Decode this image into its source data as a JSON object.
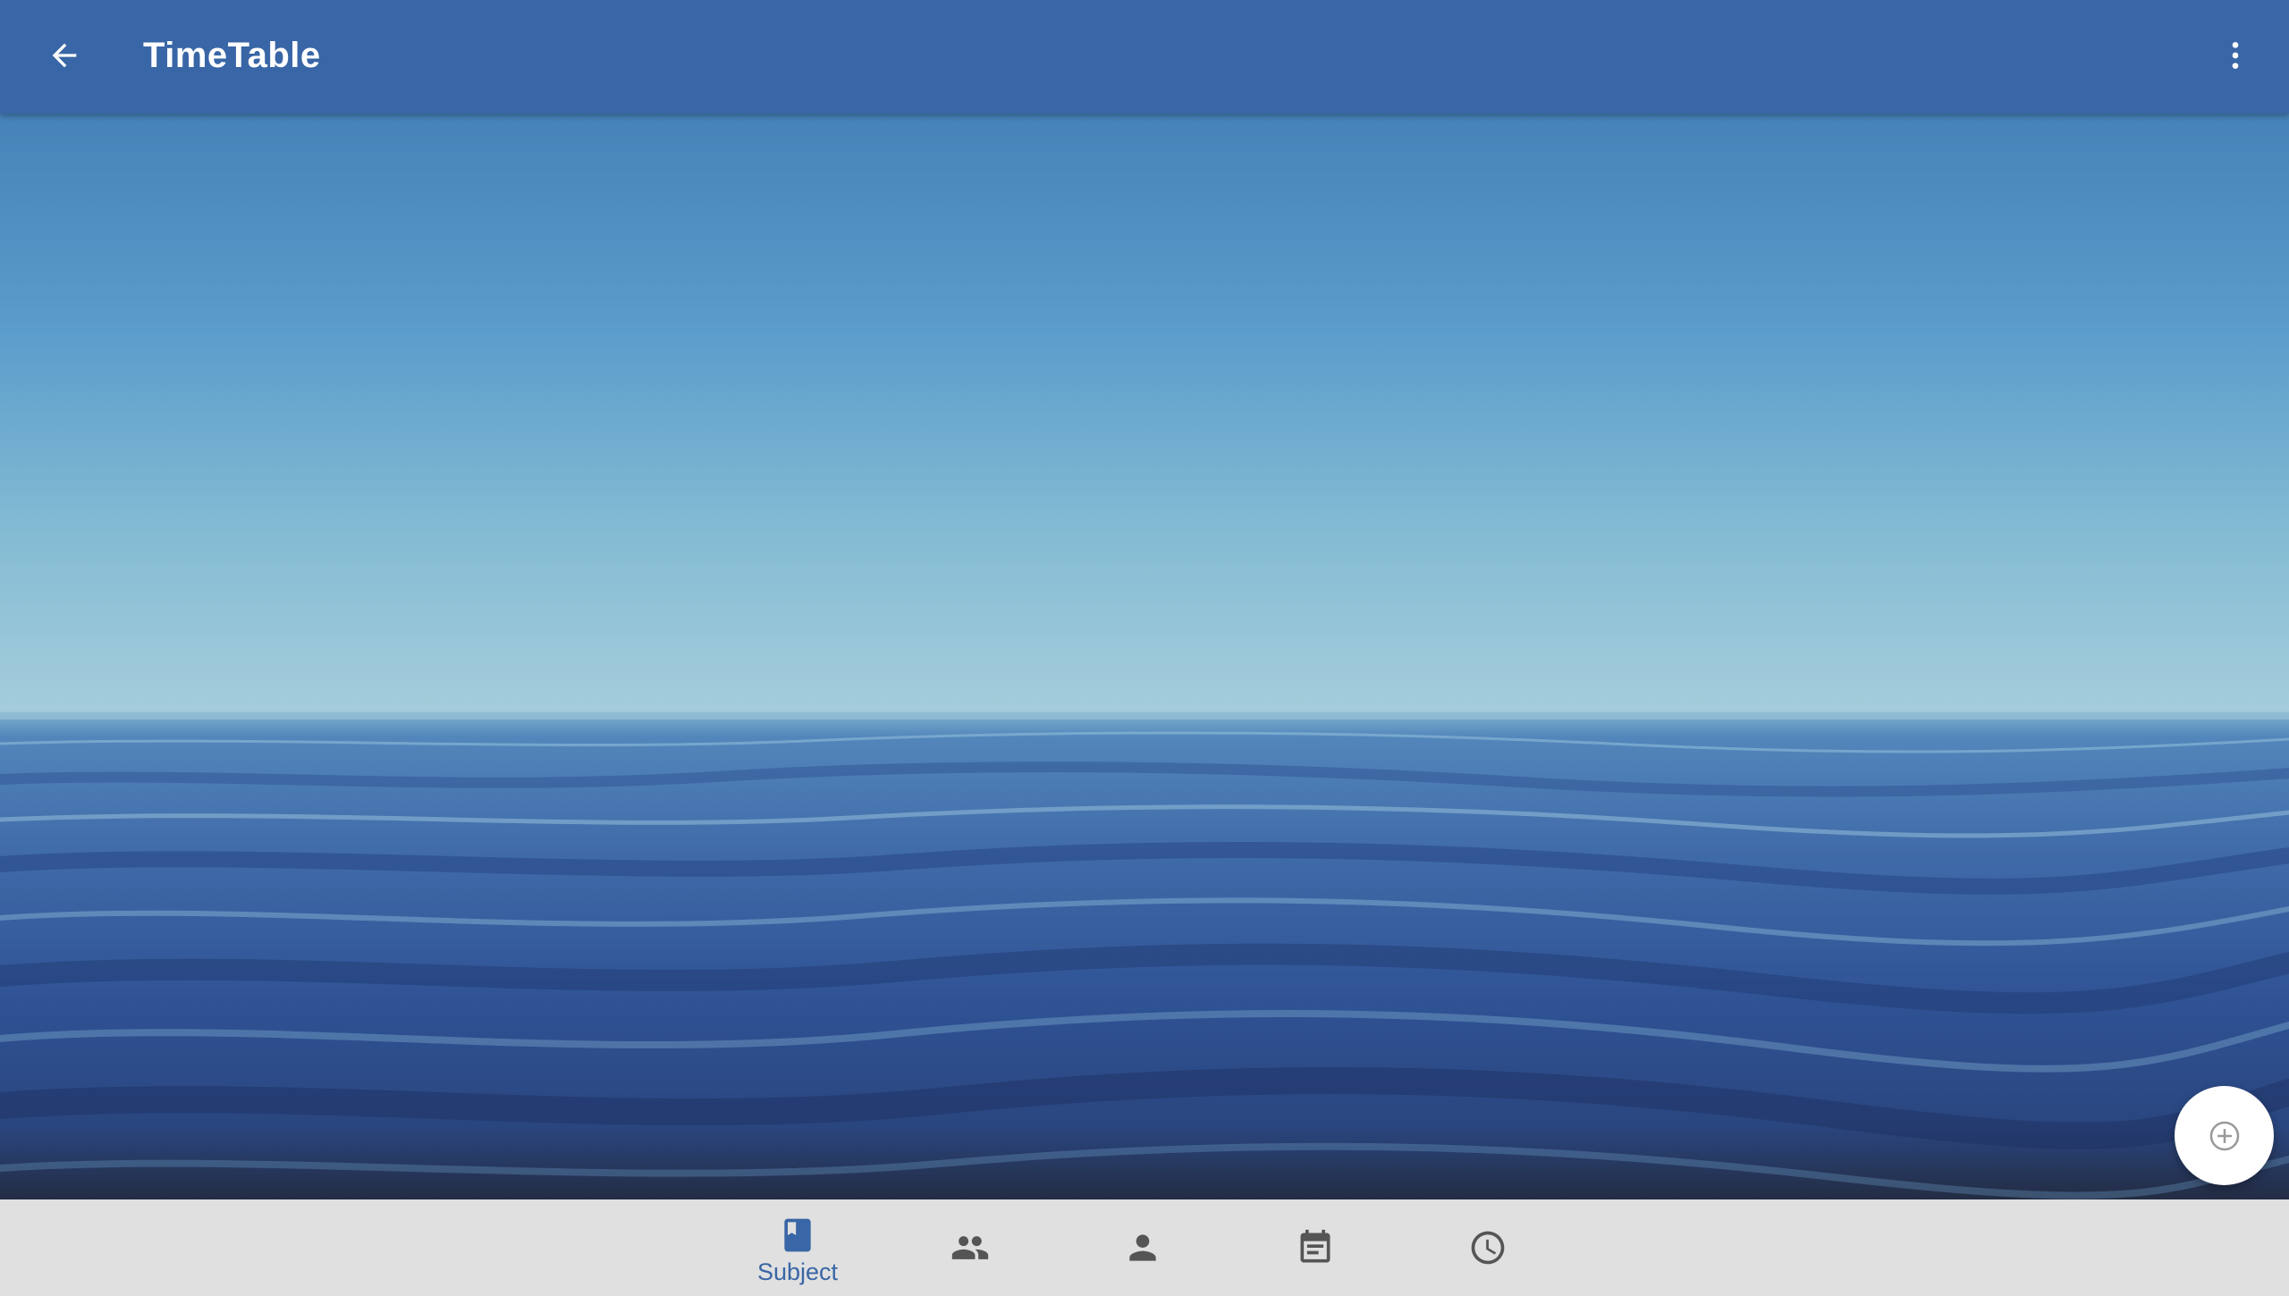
{
  "app_bar": {
    "title": "TimeTable",
    "back_icon": "arrow-back-icon",
    "overflow_icon": "more-vert-icon"
  },
  "fab": {
    "icon": "add-circle-outline-icon"
  },
  "bottom_nav": {
    "items": [
      {
        "label": "Subject",
        "icon": "book-icon",
        "selected": true
      },
      {
        "label": "",
        "icon": "people-icon",
        "selected": false
      },
      {
        "label": "",
        "icon": "person-icon",
        "selected": false
      },
      {
        "label": "",
        "icon": "calendar-event-icon",
        "selected": false
      },
      {
        "label": "",
        "icon": "clock-icon",
        "selected": false
      }
    ]
  },
  "colors": {
    "primary": "#3966a6",
    "nav_background": "#e0e0e0",
    "nav_inactive": "#555555",
    "fab_background": "#ffffff"
  }
}
